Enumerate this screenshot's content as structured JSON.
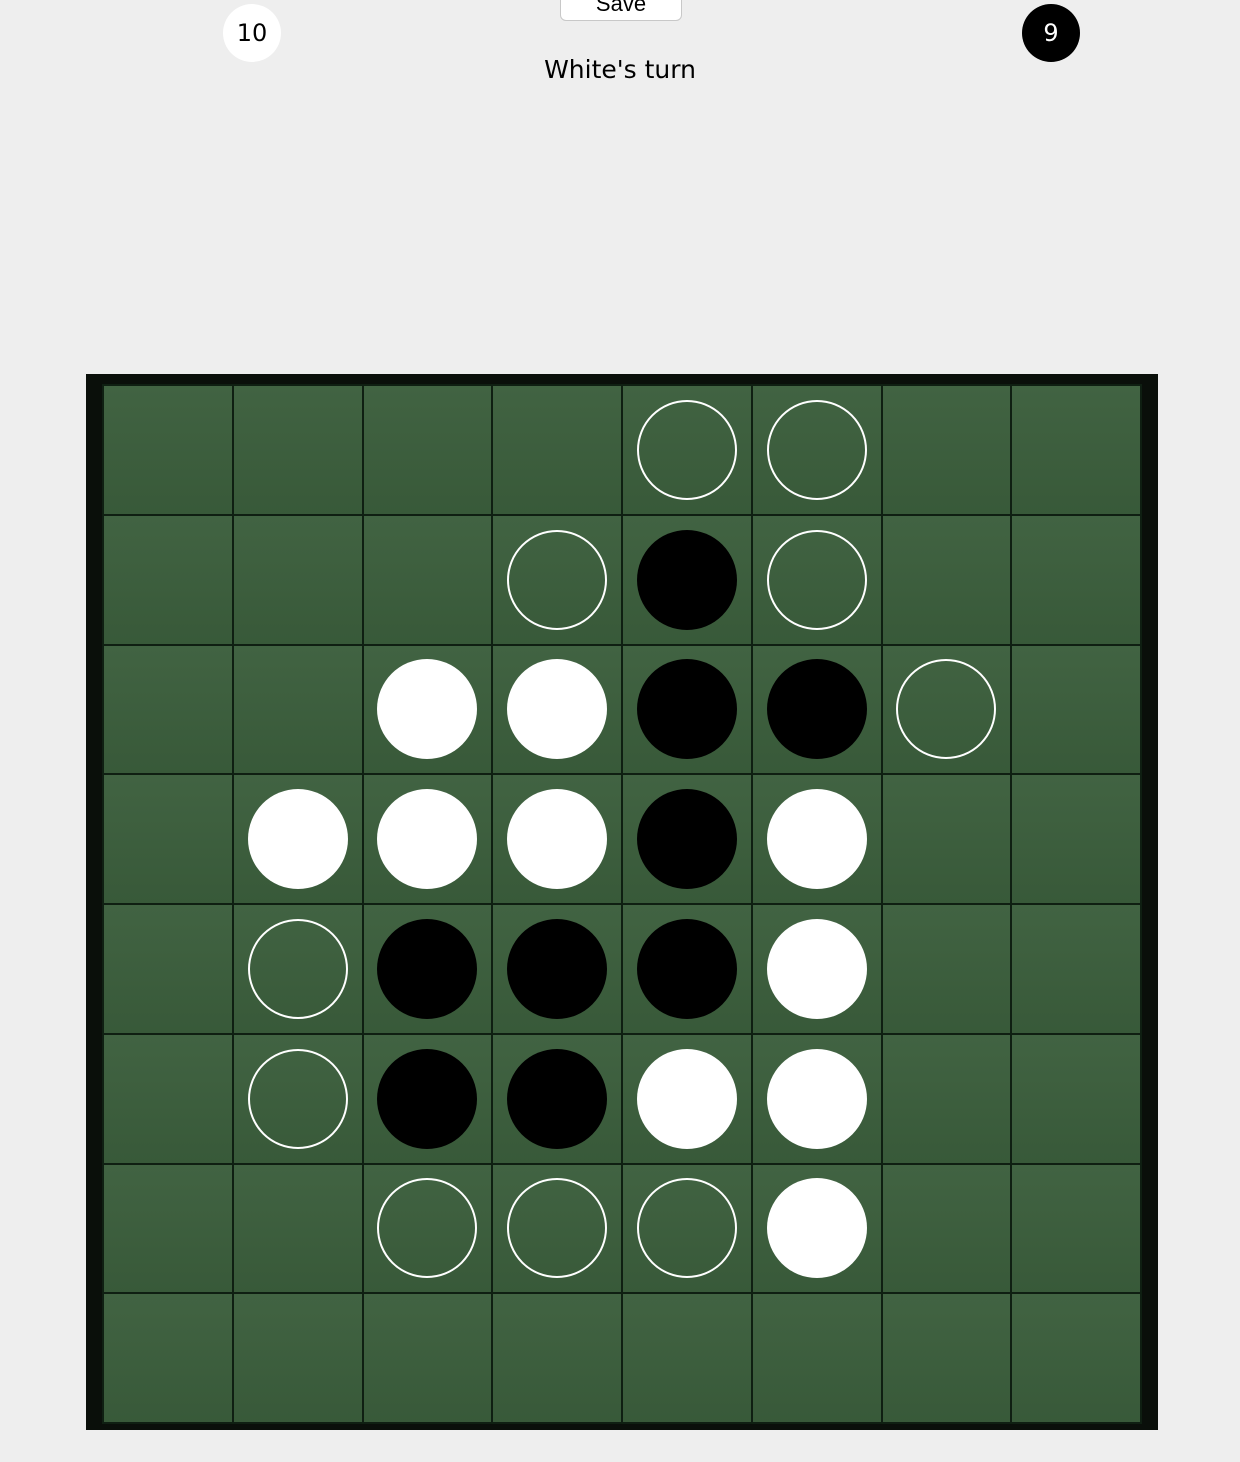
{
  "toolbar": {
    "save_label": "Save"
  },
  "scores": {
    "white": "10",
    "black": "9"
  },
  "status": {
    "turn_text": "White's turn"
  },
  "colors": {
    "board_green": "#3b5e3c",
    "board_frame": "#0a0f0a",
    "white_disc": "#ffffff",
    "black_disc": "#000000"
  },
  "legend": {
    "W": "white-disc",
    "B": "black-disc",
    "H": "valid-move-hint",
    ".": "empty"
  },
  "board": [
    "....HH..",
    "...HBH..",
    "..WWBBH.",
    ".WWWBW..",
    ".HBBBW..",
    ".HBBWW..",
    "..HHHW..",
    "........"
  ]
}
